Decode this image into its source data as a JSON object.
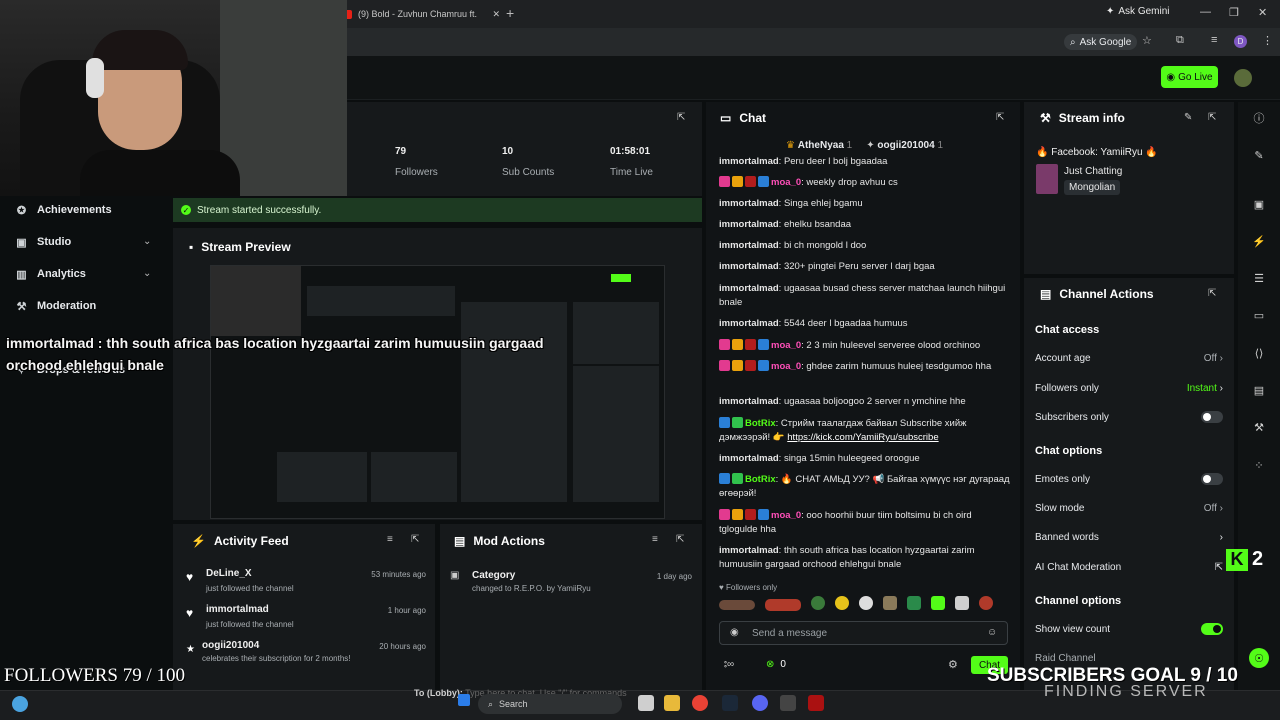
{
  "browser": {
    "tab_title": "(9) Bold - Zuvhun Chamruu ft. ",
    "new_tab": "+",
    "ask_gemini": "Ask Gemini",
    "ask_google": "Ask Google",
    "profile_initial": "D"
  },
  "header": {
    "go_live": "Go Live"
  },
  "nav": {
    "items": [
      {
        "label": "Achievements",
        "icon": "trophy-icon"
      },
      {
        "label": "Studio",
        "icon": "studio-icon"
      },
      {
        "label": "Analytics",
        "icon": "analytics-icon"
      },
      {
        "label": "Moderation",
        "icon": "wrench-icon"
      },
      {
        "label": "Drops & rewards",
        "icon": "gift-icon"
      }
    ]
  },
  "stats": [
    {
      "value": "79",
      "label": "Followers"
    },
    {
      "value": "10",
      "label": "Sub Counts"
    },
    {
      "value": "01:58:01",
      "label": "Time Live"
    }
  ],
  "toast": "Stream started successfully.",
  "preview": {
    "title": "Stream Preview"
  },
  "overlay": {
    "chat_line": "immortalmad : thh south africa bas location hyzgaartai zarim humuusiin gargaad orchood ehlehgui bnale",
    "followers": "FOLLOWERS 79 / 100",
    "sub_goal": "SUBSCRIBERS GOAL 9 / 10",
    "finding": "FINDING SERVER",
    "kick_count": "2"
  },
  "activity": {
    "title": "Activity Feed",
    "items": [
      {
        "name": "DeLine_X",
        "sub": "just followed the channel",
        "time": "53 minutes ago"
      },
      {
        "name": "immortalmad",
        "sub": "just followed the channel",
        "time": "1 hour ago"
      },
      {
        "name": "oogii201004",
        "sub": "celebrates their subscription for 2 months!",
        "time": "20 hours ago"
      }
    ]
  },
  "mod_actions": {
    "title": "Mod Actions",
    "item": {
      "label": "Category",
      "sub": "changed to R.E.P.O. by YamiiRyu",
      "time": "1 day ago"
    }
  },
  "chat": {
    "title": "Chat",
    "pinned": [
      {
        "name": "AtheNyaa",
        "count": "1"
      },
      {
        "name": "oogii201004",
        "count": "1"
      }
    ],
    "messages": [
      {
        "user": "immortalmad",
        "text": "Peru deer l bolj bgaadaa"
      },
      {
        "user": "moa_0",
        "text": "weekly drop avhuu cs"
      },
      {
        "user": "immortalmad",
        "text": "Singa ehlej bgamu"
      },
      {
        "user": "immortalmad",
        "text": "ehelku bsandaa"
      },
      {
        "user": "immortalmad",
        "text": "bi ch mongold l doo"
      },
      {
        "user": "immortalmad",
        "text": "320+ pingtei Peru server l darj bgaa"
      },
      {
        "user": "immortalmad",
        "text": "ugaasaa busad chess server matchaa launch hiihgui bnale"
      },
      {
        "user": "immortalmad",
        "text": "5544 deer l bgaadaa humuus"
      },
      {
        "user": "moa_0",
        "text": "2 3 min huleevel serveree olood orchinoo"
      },
      {
        "user": "moa_0",
        "text": "ghdee zarim humuus huleej tesdgumoo hha"
      },
      {
        "user": "immortalmad",
        "text": "ugaasaa boljoogoo 2 server n ymchine hhe"
      },
      {
        "user": "BotRix",
        "text": "Стрийм таалагдаж байвал Subscribe хийж дэмжээрэй! 👉 ",
        "link": "https://kick.com/YamiiRyu/subscribe"
      },
      {
        "user": "immortalmad",
        "text": "singa 15min huleegeed oroogue"
      },
      {
        "user": "BotRix",
        "text": "🔥 СНАТ АМЬД УУ? 📢 Байгаа хүмүүс нэг дугараад өгөөрэй!"
      },
      {
        "user": "moa_0",
        "text": "ooo hoorhii buur tiim boltsimu bi ch oird tglogulde hha"
      },
      {
        "user": "immortalmad",
        "text": "thh south africa bas location hyzgaartai zarim humuusiin gargaad orchood ehlehgui bnale"
      }
    ],
    "followers_only": "Followers only",
    "input_placeholder": "Send a message",
    "points": "0",
    "send": "Chat"
  },
  "stream_info": {
    "title": "Stream info",
    "facebook": "🔥 Facebook: YamiiRyu 🔥",
    "category": "Just Chatting",
    "tag": "Mongolian"
  },
  "channel_actions": {
    "title": "Channel Actions",
    "chat_access": "Chat access",
    "account_age": {
      "label": "Account age",
      "value": "Off"
    },
    "followers_only": {
      "label": "Followers only",
      "value": "Instant"
    },
    "subscribers_only": {
      "label": "Subscribers only"
    },
    "chat_options": "Chat options",
    "emotes_only": {
      "label": "Emotes only"
    },
    "slow_mode": {
      "label": "Slow mode",
      "value": "Off"
    },
    "banned_words": {
      "label": "Banned words"
    },
    "ai_mod": {
      "label": "AI Chat Moderation"
    },
    "channel_options": "Channel options",
    "show_view_count": {
      "label": "Show view count"
    },
    "raid_channel": {
      "label": "Raid Channel"
    }
  },
  "taskbar": {
    "search": "Search",
    "lobby_prefix": "To (Lobby):",
    "lobby_hint": "Type here to chat. Use \"/\" for commands"
  },
  "colors": {
    "accent": "#53fc18",
    "moa": "#ff4fb8",
    "panel": "#16191b",
    "bg": "#0b0e0f"
  }
}
